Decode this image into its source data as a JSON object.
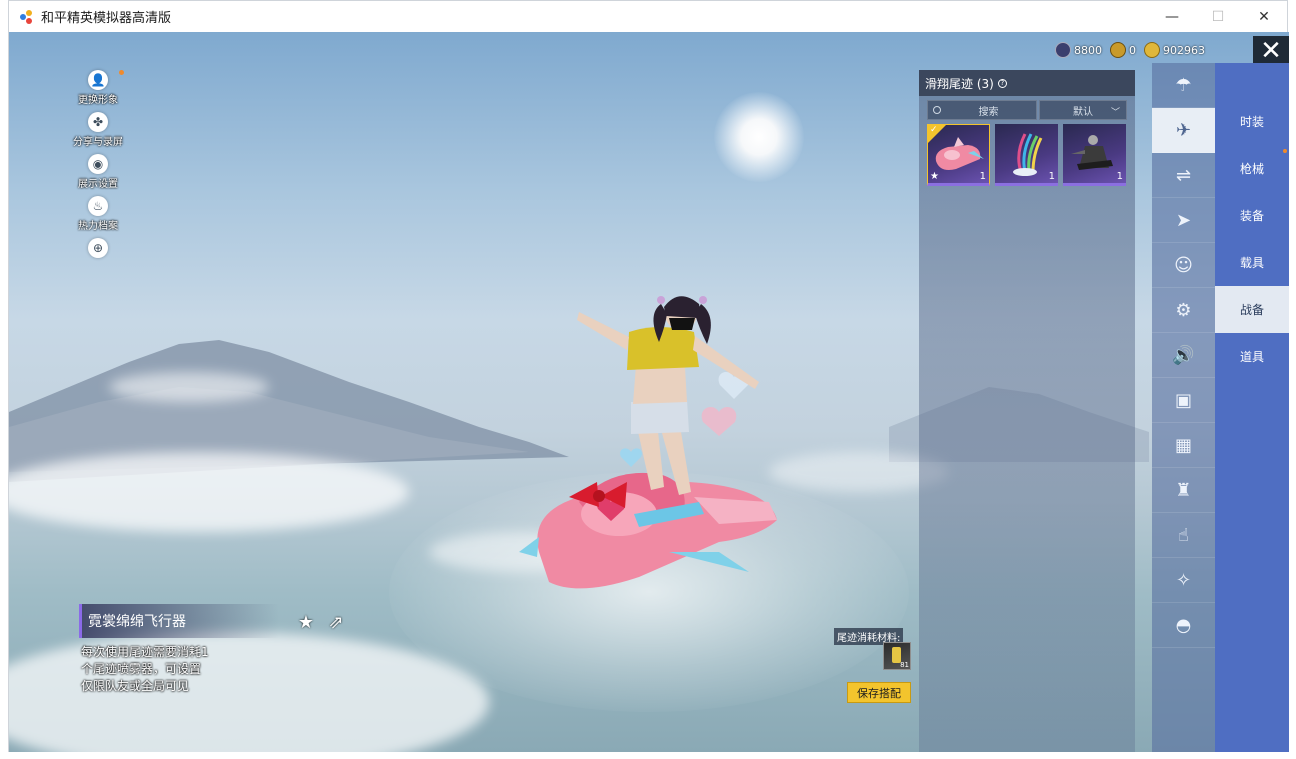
{
  "window": {
    "title": "和平精英模拟器高清版",
    "minimize": "—",
    "maximize": "☐",
    "close": "✕"
  },
  "left_menu": [
    {
      "label": "更换形象",
      "icon": "avatar-icon"
    },
    {
      "label": "分享与录屏",
      "icon": "share-record-icon"
    },
    {
      "label": "展示设置",
      "icon": "eye-icon"
    },
    {
      "label": "热力档案",
      "icon": "flame-icon"
    },
    {
      "label": "",
      "icon": "add-icon"
    }
  ],
  "currency": [
    {
      "value": "8800",
      "icon": "coin-dark-icon",
      "color": "#3b3f6e"
    },
    {
      "value": "0",
      "icon": "coin-gold-icon",
      "color": "#c99a2a"
    },
    {
      "value": "902963",
      "icon": "coin-yellow-icon",
      "color": "#e0b73a"
    }
  ],
  "game_close": "✕",
  "panel": {
    "title": "滑翔尾迹 (3)",
    "info": "?",
    "search_label": "搜索",
    "sort_label": "默认",
    "items": [
      {
        "qty": "1",
        "selected": true,
        "star": true
      },
      {
        "qty": "1",
        "selected": false,
        "star": false
      },
      {
        "qty": "1",
        "selected": false,
        "star": false
      }
    ]
  },
  "categories": [
    {
      "icon": "parachute-icon",
      "active": false
    },
    {
      "icon": "glider-trail-icon",
      "active": true
    },
    {
      "icon": "drone-icon",
      "active": false
    },
    {
      "icon": "plane-icon",
      "active": false
    },
    {
      "icon": "emote-icon",
      "active": false
    },
    {
      "icon": "robot-icon",
      "active": false
    },
    {
      "icon": "speaker-icon",
      "active": false
    },
    {
      "icon": "badge-icon",
      "active": false
    },
    {
      "icon": "photo-icon",
      "active": false
    },
    {
      "icon": "extinguisher-icon",
      "active": false
    },
    {
      "icon": "tap-icon",
      "active": false
    },
    {
      "icon": "wand-icon",
      "active": false
    },
    {
      "icon": "helmet-icon",
      "active": false
    }
  ],
  "tabs": [
    {
      "label": "时装",
      "active": false
    },
    {
      "label": "枪械",
      "active": false
    },
    {
      "label": "装备",
      "active": false
    },
    {
      "label": "载具",
      "active": false
    },
    {
      "label": "战备",
      "active": true
    },
    {
      "label": "道具",
      "active": false
    }
  ],
  "item": {
    "name": "霓裳绵绵飞行器",
    "desc_1": "每次使用尾迹需要消耗1",
    "desc_2": "个尾迹喷雾器，可设置",
    "desc_3": "仅限队友或全局可见"
  },
  "material": {
    "label": "尾迹消耗材料:",
    "count": "81"
  },
  "save_label": "保存搭配"
}
